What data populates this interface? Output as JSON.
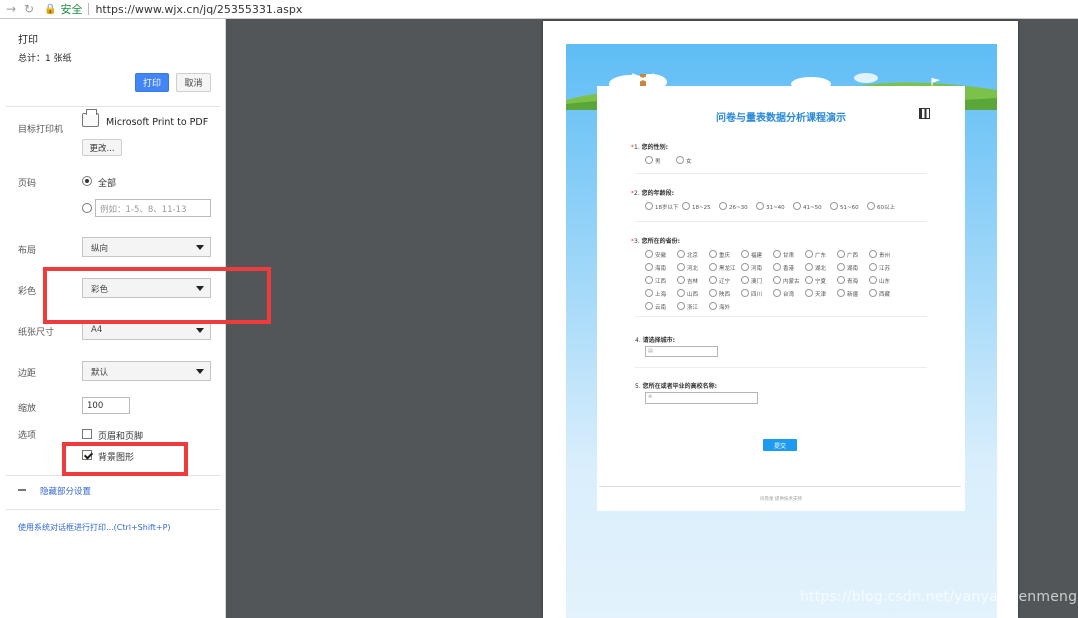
{
  "browser": {
    "secure_label": "安全",
    "url": "https://www.wjx.cn/jq/25355331.aspx"
  },
  "print_panel": {
    "title": "打印",
    "total": "总计：1 张纸",
    "print_button": "打印",
    "cancel_button": "取消",
    "destination_label": "目标打印机",
    "printer_name": "Microsoft Print to PDF",
    "change_button": "更改...",
    "pages_label": "页码",
    "pages_all": "全部",
    "pages_placeholder": "例如：1-5、8、11-13",
    "layout_label": "布局",
    "layout_value": "纵向",
    "color_label": "彩色",
    "color_value": "彩色",
    "paper_label": "纸张尺寸",
    "paper_value": "A4",
    "margins_label": "边距",
    "margins_value": "默认",
    "scale_label": "缩放",
    "scale_value": "100",
    "options_label": "选项",
    "option_headers": "页眉和页脚",
    "option_background": "背景图形",
    "hide_settings": "隐藏部分设置",
    "system_dialog": "使用系统对话框进行打印...(Ctrl+Shift+P)"
  },
  "survey": {
    "title": "问卷与量表数据分析课程演示",
    "q1": {
      "number": "1.",
      "text": "您的性别:",
      "options": [
        "男",
        "女"
      ]
    },
    "q2": {
      "number": "2.",
      "text": "您的年龄段:",
      "options": [
        "18岁以下",
        "18~25",
        "26~30",
        "31~40",
        "41~50",
        "51~60",
        "60以上"
      ]
    },
    "q3": {
      "number": "3.",
      "text": "您所在的省份:",
      "options": [
        "安徽",
        "北京",
        "重庆",
        "福建",
        "甘肃",
        "广东",
        "广西",
        "贵州",
        "海南",
        "河北",
        "黑龙江",
        "河南",
        "香港",
        "湖北",
        "湖南",
        "江苏",
        "江西",
        "吉林",
        "辽宁",
        "澳门",
        "内蒙古",
        "宁夏",
        "青海",
        "山东",
        "上海",
        "山西",
        "陕西",
        "四川",
        "台湾",
        "天津",
        "新疆",
        "西藏",
        "云南",
        "浙江",
        "海外"
      ]
    },
    "q4": {
      "number": "4.",
      "text": "请选择城市:"
    },
    "q5": {
      "number": "5.",
      "text": "您所在或者毕业的高校名称:"
    },
    "submit": "提交",
    "footer": "问卷星 提供技术支持"
  },
  "watermark": "https://blog.csdn.net/yanyanwenmeng",
  "colors": {
    "highlight": "#ef3b3b",
    "accent": "#4285f4",
    "link": "#3367d6"
  }
}
